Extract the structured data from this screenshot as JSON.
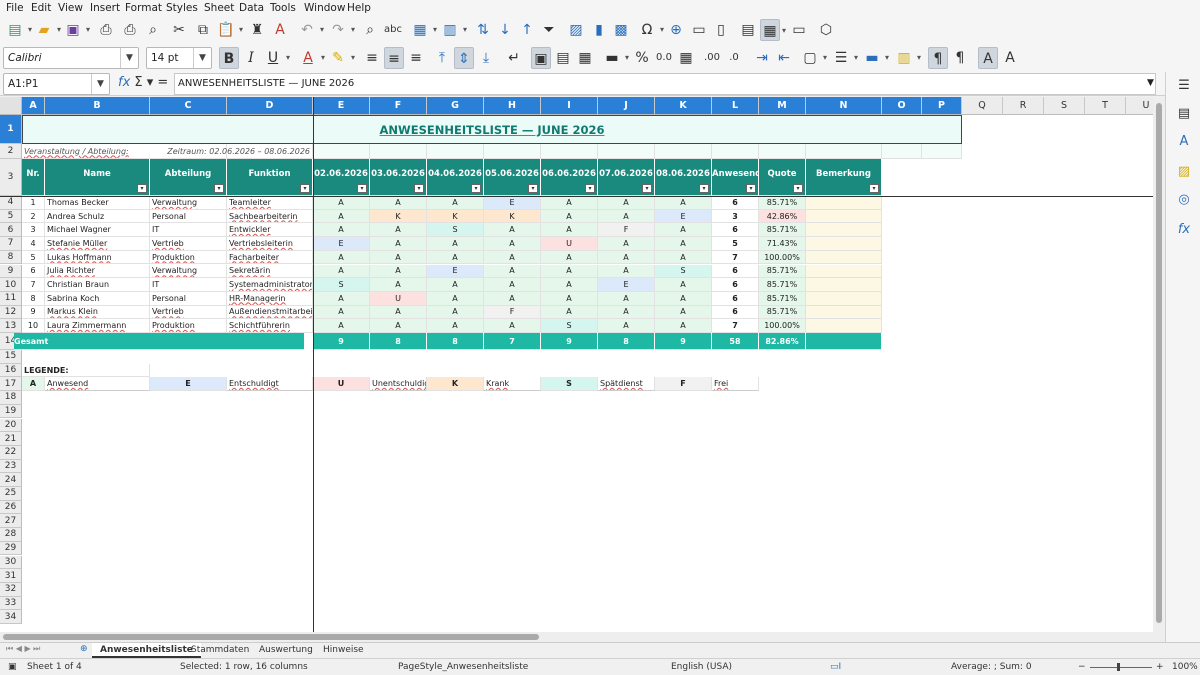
{
  "menu": [
    "File",
    "Edit",
    "View",
    "Insert",
    "Format",
    "Styles",
    "Sheet",
    "Data",
    "Tools",
    "Window",
    "Help"
  ],
  "font": {
    "name": "Calibri",
    "size": "14 pt"
  },
  "formula_bar": {
    "name_box": "A1:P1",
    "formula": "ANWESENHEITSLISTE — JUNE 2026"
  },
  "sheet": {
    "columns": [
      "A",
      "B",
      "C",
      "D",
      "E",
      "F",
      "G",
      "H",
      "I",
      "J",
      "K",
      "L",
      "M",
      "N",
      "O",
      "P",
      "Q",
      "R",
      "S",
      "T",
      "U"
    ],
    "selected_columns": [
      "A",
      "B",
      "C",
      "D",
      "E",
      "F",
      "G",
      "H",
      "I",
      "J",
      "K",
      "L",
      "M",
      "N",
      "O",
      "P"
    ],
    "title": "ANWESENHEITSLISTE — JUNE 2026",
    "row2_left": "Veranstaltung / Abteilung:",
    "row2_right": "Zeitraum: 02.06.2026 – 08.06.2026",
    "headers": [
      "Nr.",
      "Name",
      "Abteilung",
      "Funktion",
      "02.06.2026",
      "03.06.2026",
      "04.06.2026",
      "05.06.2026",
      "06.06.2026",
      "07.06.2026",
      "08.06.2026",
      "Anwesend",
      "Quote",
      "Bemerkung"
    ],
    "rows": [
      {
        "nr": "1",
        "name": "Thomas Becker",
        "abt": "Verwaltung",
        "funk": "Teamleiter",
        "days": [
          "A",
          "A",
          "A",
          "E",
          "A",
          "A",
          "A"
        ],
        "anw": "6",
        "quote": "85.71%"
      },
      {
        "nr": "2",
        "name": "Andrea Schulz",
        "abt": "Personal",
        "funk": "Sachbearbeiterin",
        "days": [
          "A",
          "K",
          "K",
          "K",
          "A",
          "A",
          "E"
        ],
        "anw": "3",
        "quote": "42.86%"
      },
      {
        "nr": "3",
        "name": "Michael Wagner",
        "abt": "IT",
        "funk": "Entwickler",
        "days": [
          "A",
          "A",
          "S",
          "A",
          "A",
          "F",
          "A"
        ],
        "anw": "6",
        "quote": "85.71%"
      },
      {
        "nr": "4",
        "name": "Stefanie Müller",
        "abt": "Vertrieb",
        "funk": "Vertriebsleiterin",
        "days": [
          "E",
          "A",
          "A",
          "A",
          "U",
          "A",
          "A"
        ],
        "anw": "5",
        "quote": "71.43%"
      },
      {
        "nr": "5",
        "name": "Lukas Hoffmann",
        "abt": "Produktion",
        "funk": "Facharbeiter",
        "days": [
          "A",
          "A",
          "A",
          "A",
          "A",
          "A",
          "A"
        ],
        "anw": "7",
        "quote": "100.00%"
      },
      {
        "nr": "6",
        "name": "Julia Richter",
        "abt": "Verwaltung",
        "funk": "Sekretärin",
        "days": [
          "A",
          "A",
          "E",
          "A",
          "A",
          "A",
          "S"
        ],
        "anw": "6",
        "quote": "85.71%"
      },
      {
        "nr": "7",
        "name": "Christian Braun",
        "abt": "IT",
        "funk": "Systemadministrator",
        "days": [
          "S",
          "A",
          "A",
          "A",
          "A",
          "E",
          "A"
        ],
        "anw": "6",
        "quote": "85.71%"
      },
      {
        "nr": "8",
        "name": "Sabrina Koch",
        "abt": "Personal",
        "funk": "HR-Managerin",
        "days": [
          "A",
          "U",
          "A",
          "A",
          "A",
          "A",
          "A"
        ],
        "anw": "6",
        "quote": "85.71%"
      },
      {
        "nr": "9",
        "name": "Markus Klein",
        "abt": "Vertrieb",
        "funk": "Außendienstmitarbeiter",
        "days": [
          "A",
          "A",
          "A",
          "F",
          "A",
          "A",
          "A"
        ],
        "anw": "6",
        "quote": "85.71%"
      },
      {
        "nr": "10",
        "name": "Laura Zimmermann",
        "abt": "Produktion",
        "funk": "Schichtführerin",
        "days": [
          "A",
          "A",
          "A",
          "A",
          "S",
          "A",
          "A"
        ],
        "anw": "7",
        "quote": "100.00%"
      }
    ],
    "total": {
      "label": "Gesamt",
      "days": [
        "9",
        "8",
        "8",
        "7",
        "9",
        "8",
        "9"
      ],
      "anw": "58",
      "quote": "82.86%"
    },
    "legend_title": "LEGENDE:",
    "legend": [
      {
        "code": "A",
        "text": "Anwesend"
      },
      {
        "code": "E",
        "text": "Entschuldigt"
      },
      {
        "code": "U",
        "text": "Unentschuldigt"
      },
      {
        "code": "K",
        "text": "Krank"
      },
      {
        "code": "S",
        "text": "Spätdienst"
      },
      {
        "code": "F",
        "text": "Frei"
      }
    ]
  },
  "tabs": [
    "Anwesenheitsliste",
    "Stammdaten",
    "Auswertung",
    "Hinweise"
  ],
  "status": {
    "sheet": "Sheet 1 of 4",
    "selection": "Selected: 1 row, 16 columns",
    "pagestyle": "PageStyle_Anwesenheitsliste",
    "language": "English (USA)",
    "sum": "Average: ; Sum: 0",
    "zoom": "100%"
  }
}
